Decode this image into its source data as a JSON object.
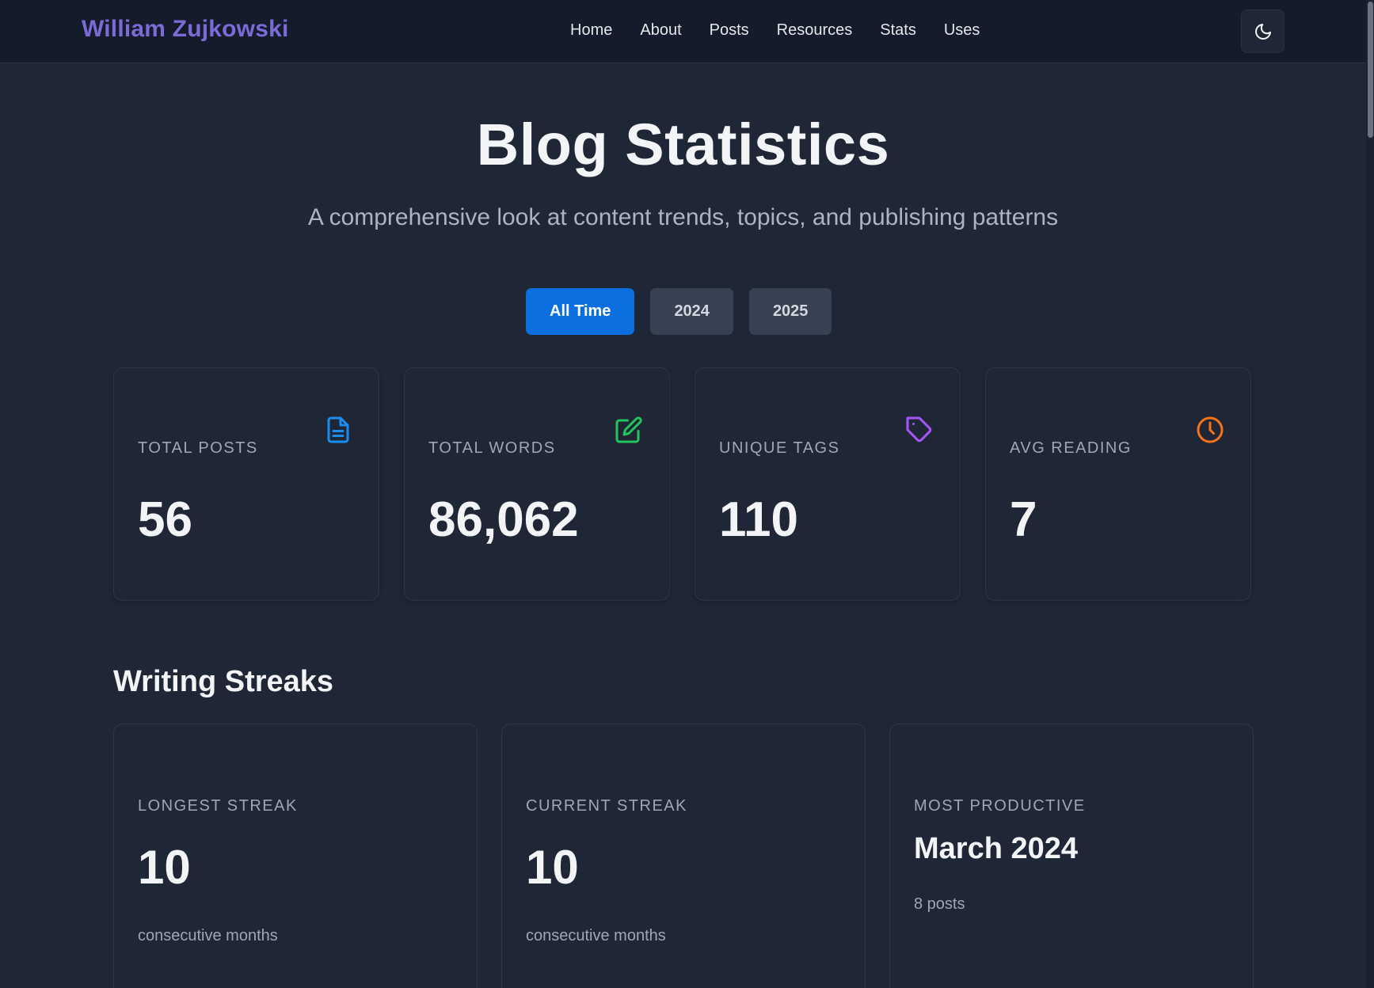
{
  "header": {
    "brand": "William Zujkowski",
    "nav": [
      "Home",
      "About",
      "Posts",
      "Resources",
      "Stats",
      "Uses"
    ],
    "theme_toggle_icon": "moon-icon"
  },
  "hero": {
    "title": "Blog Statistics",
    "subtitle": "A comprehensive look at content trends, topics, and publishing patterns"
  },
  "filters": {
    "options": [
      "All Time",
      "2024",
      "2025"
    ],
    "selected": "All Time"
  },
  "stats": [
    {
      "label": "TOTAL POSTS",
      "value": "56",
      "icon": "document-icon",
      "color": "#1a8df0"
    },
    {
      "label": "TOTAL WORDS",
      "value": "86,062",
      "icon": "edit-icon",
      "color": "#22c55e"
    },
    {
      "label": "UNIQUE TAGS",
      "value": "110",
      "icon": "tag-icon",
      "color": "#a855f7"
    },
    {
      "label": "AVG READING",
      "value": "7",
      "icon": "clock-icon",
      "color": "#f97316"
    }
  ],
  "streaks": {
    "title": "Writing Streaks",
    "items": [
      {
        "label": "LONGEST STREAK",
        "value": "10",
        "note": "consecutive months"
      },
      {
        "label": "CURRENT STREAK",
        "value": "10",
        "note": "consecutive months"
      },
      {
        "label": "MOST PRODUCTIVE",
        "value": "March 2024",
        "note": "8 posts"
      }
    ]
  },
  "colors": {
    "background": "#1f2737",
    "header_bg": "#141b2a",
    "brand": "#7c6bd6",
    "accent": "#0b6fe0"
  }
}
